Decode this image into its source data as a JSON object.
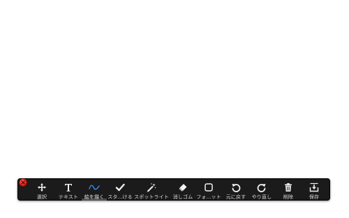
{
  "toolbar": {
    "close_icon": "close-icon",
    "accent_color": "#3a8ee6",
    "tools": [
      {
        "icon": "move-icon",
        "label": "選択"
      },
      {
        "icon": "text-icon",
        "label": "テキスト"
      },
      {
        "icon": "draw-icon",
        "label": "絵を描く",
        "active": true
      },
      {
        "icon": "checkmark-icon",
        "label": "スタ…ける"
      },
      {
        "icon": "magic-wand-icon",
        "label": "スポットライト"
      },
      {
        "icon": "eraser-icon",
        "label": "消しゴム"
      },
      {
        "icon": "frame-icon",
        "label": "フォ…ット"
      },
      {
        "icon": "undo-icon",
        "label": "元に戻す"
      },
      {
        "icon": "redo-icon",
        "label": "やり直し"
      },
      {
        "icon": "trash-icon",
        "label": "削除"
      },
      {
        "icon": "save-icon",
        "label": "保存"
      }
    ]
  }
}
